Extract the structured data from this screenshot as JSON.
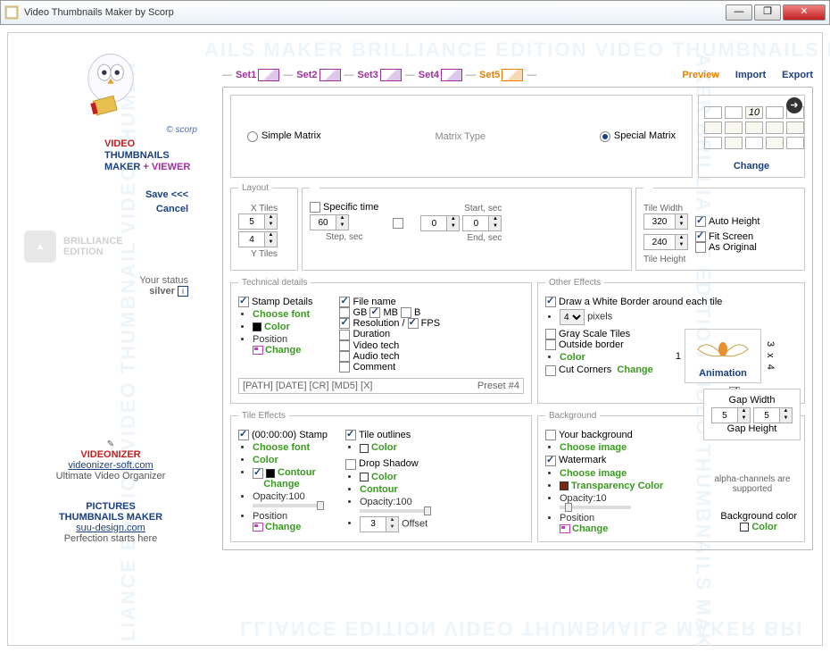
{
  "window": {
    "title": "Video Thumbnails Maker by Scorp"
  },
  "brand": {
    "copyright": "© scorp",
    "line1": "VIDEO",
    "line2": "THUMBNAILS",
    "line3a": "MAKER",
    "line3plus": "+",
    "line3b": "VIEWER"
  },
  "actions": {
    "save": "Save <<<",
    "cancel": "Cancel"
  },
  "edition": {
    "line1": "BRILLIANCE",
    "line2": "EDITION"
  },
  "status": {
    "label": "Your status",
    "level": "silver",
    "info": "i"
  },
  "promo1": {
    "title": "VIDEONIZER",
    "url": "videonizer-soft.com",
    "sub": "Ultimate Video Organizer"
  },
  "promo2": {
    "title1": "PICTURES",
    "title2": "THUMBNAILS MAKER",
    "url": "suu-design.com",
    "sub": "Perfection starts here"
  },
  "tabs": {
    "items": [
      "Set1",
      "Set2",
      "Set3",
      "Set4",
      "Set5"
    ],
    "preview": "Preview",
    "import": "Import",
    "export": "Export"
  },
  "matrix": {
    "simple": "Simple Matrix",
    "label": "Matrix Type",
    "special": "Special Matrix",
    "change": "Change",
    "ten": "10"
  },
  "layout": {
    "legend": "Layout",
    "xtiles": "5",
    "ytiles": "4",
    "xtiles_label": "X Tiles",
    "ytiles_label": "Y Tiles",
    "specific": "Specific time",
    "step": "60",
    "step_label": "Step, sec",
    "start": "0",
    "start_label": "Start, sec",
    "end": "0",
    "end_label": "End, sec",
    "tilewidth": "320",
    "tilewidth_label": "Tile Width",
    "tileheight": "240",
    "tileheight_label": "Tile Height",
    "autoh": "Auto Height",
    "fit": "Fit Screen",
    "orig": "As Original"
  },
  "tech": {
    "legend": "Technical  details",
    "stamp": "Stamp Details",
    "choosefont": "Choose font",
    "color": "Color",
    "position": "Position",
    "change": "Change",
    "filename": "File name",
    "gb": "GB",
    "mb": "MB",
    "b": "B",
    "resolution": "Resolution /",
    "fps": "FPS",
    "duration": "Duration",
    "videotech": "Video tech",
    "audiotech": "Audio tech",
    "comment": "Comment",
    "preset_line": "[PATH] [DATE] [CR] [MD5] [X]",
    "preset": "Preset #4"
  },
  "other": {
    "legend": "Other Effects",
    "border": "Draw a White Border around each tile",
    "pixels": "pixels",
    "pxval": "4",
    "gray": "Gray Scale Tiles",
    "outside": "Outside border",
    "color": "Color",
    "cut": "Cut Corners",
    "change": "Change",
    "animation": "Animation",
    "n1": "1",
    "dim": "3 x 4"
  },
  "tile": {
    "legend": "Tile Effects",
    "stamp": "(00:00:00) Stamp",
    "choosefont": "Choose font",
    "color": "Color",
    "contour": "Contour",
    "change": "Change",
    "opacity": "Opacity:",
    "opval": "100",
    "position": "Position",
    "outlines": "Tile outlines",
    "drop": "Drop Shadow",
    "offset": "Offset",
    "offval": "3"
  },
  "bg": {
    "legend": "Background",
    "your": "Your background",
    "chooseimg": "Choose image",
    "watermark": "Watermark",
    "transp": "Transparency Color",
    "opacity": "Opacity:",
    "opval": "10",
    "position": "Position",
    "change": "Change",
    "gapw": "Gap Width",
    "gapwval": "5",
    "gaph": "Gap Height",
    "gaphval": "5",
    "alpha": "alpha-channels are supported",
    "bgcolor": "Background color",
    "color": "Color"
  }
}
